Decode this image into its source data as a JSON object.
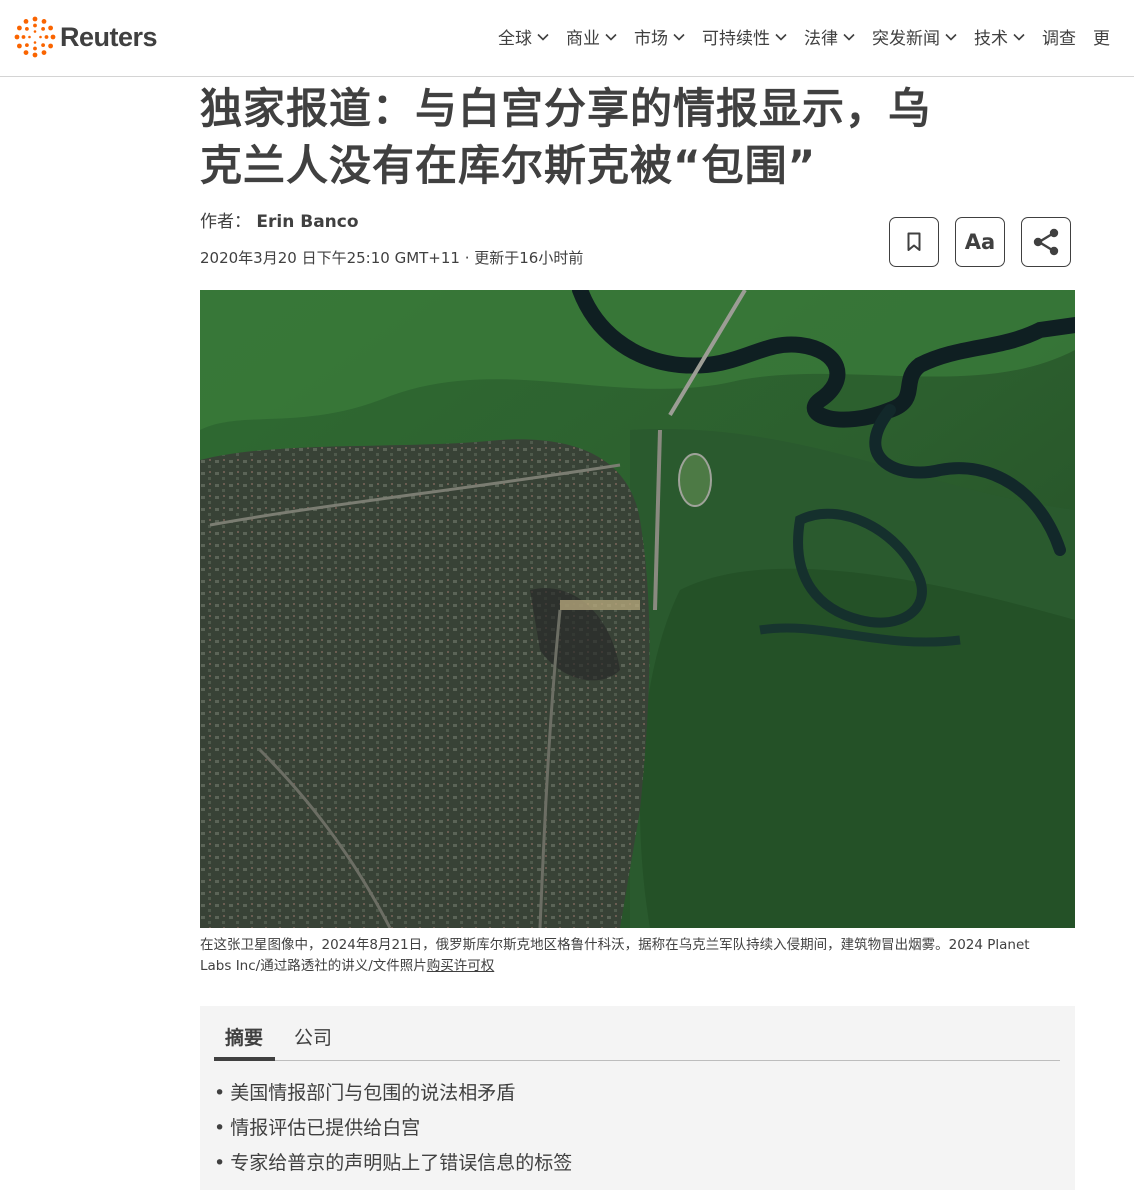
{
  "header": {
    "logo_text": "Reuters",
    "brand_color": "#fa6400",
    "nav": [
      {
        "label": "全球",
        "has_dropdown": true
      },
      {
        "label": "商业",
        "has_dropdown": true
      },
      {
        "label": "市场",
        "has_dropdown": true
      },
      {
        "label": "可持续性",
        "has_dropdown": true
      },
      {
        "label": "法律",
        "has_dropdown": true
      },
      {
        "label": "突发新闻",
        "has_dropdown": true
      },
      {
        "label": "技术",
        "has_dropdown": true
      },
      {
        "label": "调查",
        "has_dropdown": false
      },
      {
        "label": "更",
        "has_dropdown": false
      }
    ]
  },
  "article": {
    "headline_line1": "独家报道：与白宫分享的情报显示，乌",
    "headline_line2": "克兰人没有在库尔斯克被“包围”",
    "byline_prefix": "作者：",
    "author": "Erin Banco",
    "dateline": "2020年3月20 日下午25:10 GMT+11 · 更新于16小时前",
    "tools": {
      "bookmark_icon": "bookmark-icon",
      "text_size_label": "Aa",
      "share_icon": "share-icon"
    },
    "caption_text": "在这张卫星图像中，2024年8月21日，俄罗斯库尔斯克地区格鲁什科沃，据称在乌克兰军队持续入侵期间，建筑物冒出烟雾。2024 Planet Labs Inc/通过路透社的讲义/文件照片",
    "caption_link": "购买许可权"
  },
  "summary": {
    "tabs": [
      {
        "label": "摘要",
        "active": true
      },
      {
        "label": "公司",
        "active": false
      }
    ],
    "bullets": [
      "美国情报部门与包围的说法相矛盾",
      "情报评估已提供给白宫",
      "专家给普京的声明贴上了错误信息的标签"
    ]
  }
}
